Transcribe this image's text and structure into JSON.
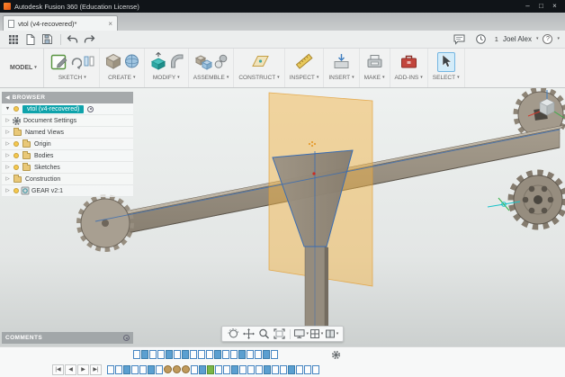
{
  "titlebar": {
    "title": "Autodesk Fusion 360 (Education License)",
    "minimize": "–",
    "maximize": "□",
    "close": "×"
  },
  "tabbar": {
    "active_tab": "vtol (v4-recovered)*",
    "close": "×"
  },
  "quick_access": {
    "right": {
      "notification_count": "1",
      "user_name": "Joel Alex",
      "help": "?"
    }
  },
  "toolbar": {
    "workspace": "MODEL",
    "groups": [
      {
        "label": "SKETCH"
      },
      {
        "label": "CREATE"
      },
      {
        "label": "MODIFY"
      },
      {
        "label": "ASSEMBLE"
      },
      {
        "label": "CONSTRUCT"
      },
      {
        "label": "INSPECT"
      },
      {
        "label": "INSERT"
      },
      {
        "label": "MAKE"
      },
      {
        "label": "ADD-INS"
      },
      {
        "label": "SELECT"
      }
    ]
  },
  "browser": {
    "title": "BROWSER",
    "root_label": "vtol (v4-recovered)",
    "items": [
      {
        "label": "Document Settings"
      },
      {
        "label": "Named Views"
      },
      {
        "label": "Origin"
      },
      {
        "label": "Bodies"
      },
      {
        "label": "Sketches"
      },
      {
        "label": "Construction"
      },
      {
        "label": "GEAR v2:1"
      }
    ]
  },
  "comments": {
    "title": "COMMENTS"
  },
  "timeline": {
    "controls": [
      "|◀",
      "◀",
      "▶",
      "▶|"
    ],
    "features_row1": [
      "sketch",
      "solid",
      "sketch",
      "sketch",
      "solid",
      "sketch",
      "solid",
      "sketch",
      "sketch",
      "sketch",
      "solid",
      "sketch",
      "sketch",
      "solid",
      "sketch",
      "sketch",
      "solid",
      "sketch"
    ],
    "features_row2": [
      "sketch",
      "sketch",
      "solid",
      "sketch",
      "sketch",
      "solid",
      "sketch",
      "gear",
      "gear",
      "gear",
      "sketch",
      "solid",
      "green",
      "sketch",
      "sketch",
      "solid",
      "sketch",
      "sketch",
      "sketch",
      "solid",
      "sketch",
      "sketch",
      "solid",
      "sketch",
      "sketch",
      "sketch"
    ]
  },
  "colors": {
    "selection_teal": "#0fa3ab",
    "sketch_blue": "#3a6db3",
    "construction_plane_orange": "#f3b445",
    "body_tan": "#968d7f"
  }
}
